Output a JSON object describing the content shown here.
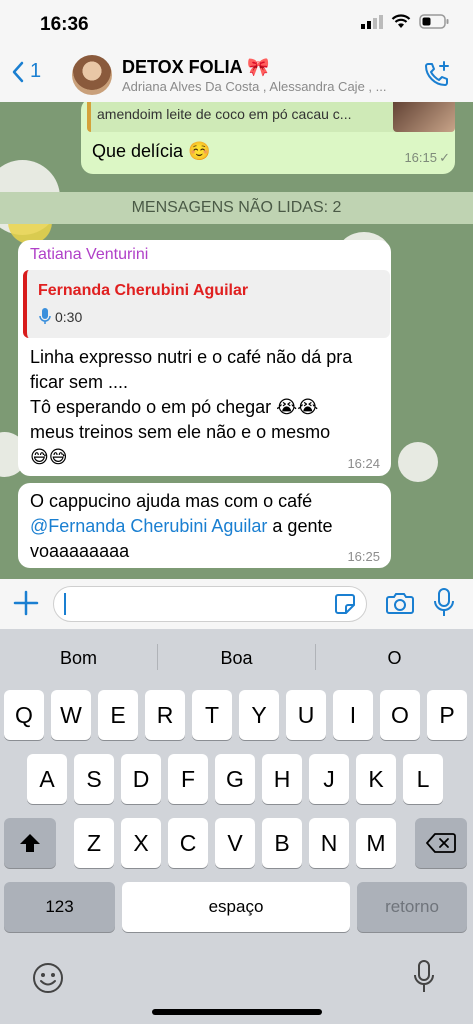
{
  "status": {
    "time": "16:36"
  },
  "header": {
    "back_count": "1",
    "title": "DETOX FOLIA 🎀",
    "subtitle": "Adriana Alves Da Costa , Alessandra Caje , ..."
  },
  "messages": {
    "outgoing": {
      "reply_text": "amendoim leite de coco em pó cacau c...",
      "text": "Que delícia ☺️",
      "time": "16:15"
    },
    "unread_label": "MENSAGENS NÃO LIDAS: 2",
    "msg1": {
      "sender": "Tatiana Venturini",
      "quote_name": "Fernanda Cherubini Aguilar",
      "quote_duration": "0:30",
      "lines": [
        "Linha expresso nutri e o café não dá pra",
        "ficar sem ....",
        "Tô esperando o em pó chegar 😭😭",
        "meus treinos sem ele não e o mesmo",
        "😅😅"
      ],
      "time": "16:24"
    },
    "msg2": {
      "line1": "O cappucino ajuda mas com o café",
      "mention": "@Fernanda Cherubini Aguilar",
      "line2_rest": " a gente",
      "line3": "voaaaaaaaa",
      "time": "16:25"
    }
  },
  "suggestions": [
    "Bom",
    "Boa",
    "O"
  ],
  "keyboard": {
    "row1": [
      "Q",
      "W",
      "E",
      "R",
      "T",
      "Y",
      "U",
      "I",
      "O",
      "P"
    ],
    "row2": [
      "A",
      "S",
      "D",
      "F",
      "G",
      "H",
      "J",
      "K",
      "L"
    ],
    "row3": [
      "Z",
      "X",
      "C",
      "V",
      "B",
      "N",
      "M"
    ],
    "numbers": "123",
    "space": "espaço",
    "return": "retorno"
  }
}
